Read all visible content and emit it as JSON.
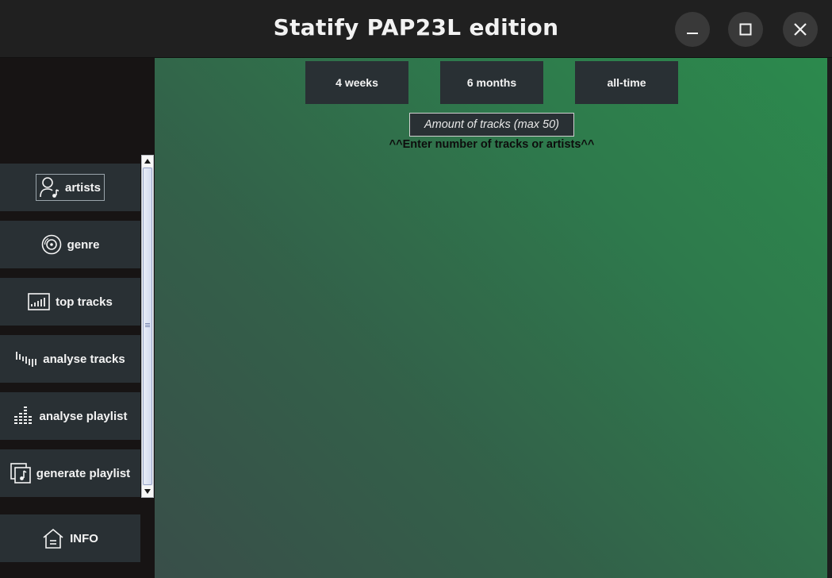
{
  "window": {
    "title": "Statify PAP23L edition",
    "controls": [
      "minimize-icon",
      "maximize-icon",
      "close-icon"
    ]
  },
  "sidebar": {
    "items": [
      {
        "label": "artists",
        "icon": "artist-icon"
      },
      {
        "label": "genre",
        "icon": "disc-icon"
      },
      {
        "label": "top tracks",
        "icon": "bar-chart-icon"
      },
      {
        "label": "analyse tracks",
        "icon": "waveform-icon"
      },
      {
        "label": "analyse playlist",
        "icon": "equalizer-icon"
      },
      {
        "label": "generate playlist",
        "icon": "playlist-icon"
      }
    ],
    "info": {
      "label": "INFO",
      "icon": "home-icon"
    }
  },
  "main": {
    "periods": [
      "4 weeks",
      "6 months",
      "all-time"
    ],
    "amount_placeholder": "Amount of tracks (max 50)",
    "hint": "^^Enter number of tracks or artists^^"
  },
  "colors": {
    "titlebar": "#202020",
    "sidebar_bg": "#171414",
    "button_bg": "#293034",
    "gradient_start": "#2c8a4d",
    "gradient_end": "#394e49"
  }
}
